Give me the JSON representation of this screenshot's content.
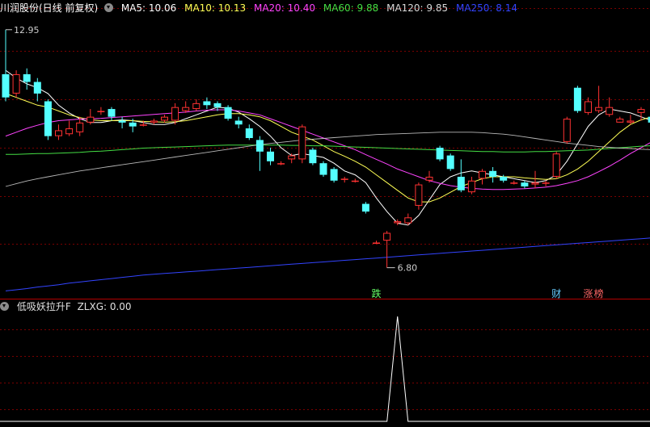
{
  "header": {
    "stock": "川润股份(日线 前复权)",
    "ma": [
      {
        "label": "MA5: 10.06",
        "color": "#ffffff"
      },
      {
        "label": "MA10: 10.13",
        "color": "#ffff55"
      },
      {
        "label": "MA20: 10.40",
        "color": "#ff44ff"
      },
      {
        "label": "MA60: 9.88",
        "color": "#44dd44"
      },
      {
        "label": "MA120: 9.85",
        "color": "#d8d8d8"
      },
      {
        "label": "MA250: 8.14",
        "color": "#3344ff"
      }
    ]
  },
  "indicator": {
    "title": "低吸妖拉升F",
    "value": "ZLXG: 0.00"
  },
  "colors": {
    "up": "#ff3232",
    "down": "#54ffff",
    "grid": "#7a0000",
    "axis": "#b40000"
  },
  "chart_data": {
    "type": "candlestick",
    "price_axis": [
      6.0,
      13.3
    ],
    "high_label": "12.95",
    "low_label": "6.80",
    "candles": [
      [
        11.8,
        11.2,
        12.95,
        11.1
      ],
      [
        11.3,
        11.8,
        11.9,
        11.2
      ],
      [
        11.8,
        11.6,
        11.95,
        11.4
      ],
      [
        11.6,
        11.3,
        11.7,
        11.1
      ],
      [
        11.1,
        10.2,
        11.15,
        10.1
      ],
      [
        10.2,
        10.35,
        10.5,
        10.1
      ],
      [
        10.25,
        10.4,
        10.6,
        10.2
      ],
      [
        10.3,
        10.55,
        10.7,
        10.2
      ],
      [
        10.55,
        10.7,
        10.9,
        10.5
      ],
      [
        10.85,
        10.85,
        10.95,
        10.75
      ],
      [
        10.9,
        10.7,
        10.95,
        10.6
      ],
      [
        10.6,
        10.55,
        10.7,
        10.4
      ],
      [
        10.55,
        10.45,
        10.65,
        10.3
      ],
      [
        10.5,
        10.5,
        10.6,
        10.45
      ],
      [
        10.55,
        10.6,
        10.65,
        10.5
      ],
      [
        10.6,
        10.7,
        10.75,
        10.55
      ],
      [
        10.6,
        10.95,
        11.05,
        10.5
      ],
      [
        10.85,
        10.95,
        11.1,
        10.8
      ],
      [
        10.9,
        11.05,
        11.15,
        10.85
      ],
      [
        11.1,
        11.0,
        11.2,
        10.9
      ],
      [
        11.05,
        10.95,
        11.1,
        10.85
      ],
      [
        10.95,
        10.65,
        11.0,
        10.6
      ],
      [
        10.6,
        10.5,
        10.7,
        10.4
      ],
      [
        10.4,
        10.15,
        10.5,
        10.1
      ],
      [
        10.1,
        9.8,
        10.2,
        9.3
      ],
      [
        9.8,
        9.55,
        9.9,
        9.45
      ],
      [
        9.5,
        9.5,
        9.55,
        9.45
      ],
      [
        9.6,
        9.7,
        9.75,
        9.5
      ],
      [
        9.6,
        10.45,
        10.5,
        9.5
      ],
      [
        9.85,
        9.5,
        9.9,
        9.45
      ],
      [
        9.5,
        9.2,
        9.55,
        9.15
      ],
      [
        9.35,
        9.05,
        9.4,
        9.0
      ],
      [
        9.1,
        9.1,
        9.15,
        9.0
      ],
      [
        9.05,
        9.05,
        9.1,
        9.0
      ],
      [
        8.45,
        8.25,
        8.5,
        8.2
      ],
      [
        7.45,
        7.45,
        7.5,
        7.45
      ],
      [
        7.5,
        7.7,
        7.75,
        6.8
      ],
      [
        7.95,
        8.0,
        8.05,
        7.9
      ],
      [
        7.95,
        8.1,
        8.2,
        7.9
      ],
      [
        8.4,
        8.95,
        9.0,
        8.3
      ],
      [
        9.05,
        9.15,
        9.3,
        9.0
      ],
      [
        9.9,
        9.6,
        9.95,
        9.55
      ],
      [
        9.7,
        9.35,
        9.75,
        9.3
      ],
      [
        9.15,
        8.8,
        9.6,
        8.75
      ],
      [
        8.75,
        9.05,
        9.15,
        8.7
      ],
      [
        9.1,
        9.3,
        9.35,
        8.95
      ],
      [
        9.3,
        9.15,
        9.4,
        9.0
      ],
      [
        9.15,
        9.05,
        9.2,
        9.0
      ],
      [
        9.0,
        9.0,
        9.05,
        8.95
      ],
      [
        9.0,
        8.9,
        9.05,
        8.85
      ],
      [
        8.95,
        9.0,
        9.3,
        8.85
      ],
      [
        9.0,
        9.0,
        9.05,
        8.9
      ],
      [
        9.15,
        9.75,
        9.8,
        9.1
      ],
      [
        10.05,
        10.65,
        10.7,
        10.0
      ],
      [
        11.45,
        10.85,
        11.5,
        10.8
      ],
      [
        10.8,
        11.1,
        11.2,
        10.75
      ],
      [
        10.85,
        10.95,
        11.5,
        10.8
      ],
      [
        10.75,
        10.95,
        11.2,
        10.7
      ],
      [
        10.55,
        10.65,
        10.7,
        10.55
      ],
      [
        10.55,
        10.6,
        10.75,
        10.5
      ],
      [
        10.8,
        10.9,
        10.95,
        10.6
      ],
      [
        10.7,
        10.55,
        10.85,
        10.5
      ]
    ],
    "ma_series": [
      {
        "name": "MA5",
        "values": [
          11.9,
          11.7,
          11.55,
          11.45,
          11.3,
          11.0,
          10.8,
          10.65,
          10.55,
          10.55,
          10.6,
          10.62,
          10.6,
          10.55,
          10.5,
          10.5,
          10.55,
          10.65,
          10.75,
          10.85,
          10.95,
          10.92,
          10.82,
          10.65,
          10.45,
          10.2,
          9.9,
          9.7,
          9.75,
          9.7,
          9.65,
          9.5,
          9.3,
          9.2,
          9.0,
          8.6,
          8.25,
          7.95,
          7.9,
          8.15,
          8.55,
          8.95,
          9.15,
          9.25,
          9.3,
          9.25,
          9.2,
          9.15,
          9.1,
          9.05,
          9.0,
          9.05,
          9.2,
          9.55,
          10.0,
          10.45,
          10.75,
          10.9,
          10.85,
          10.8,
          10.7,
          10.6
        ]
      },
      {
        "name": "MA10",
        "values": [
          11.3,
          11.2,
          11.1,
          11.0,
          10.95,
          10.85,
          10.75,
          10.68,
          10.62,
          10.6,
          10.6,
          10.6,
          10.6,
          10.58,
          10.57,
          10.56,
          10.57,
          10.6,
          10.65,
          10.7,
          10.75,
          10.78,
          10.78,
          10.75,
          10.7,
          10.6,
          10.45,
          10.3,
          10.2,
          10.1,
          9.95,
          9.8,
          9.68,
          9.55,
          9.4,
          9.2,
          9.0,
          8.8,
          8.6,
          8.5,
          8.5,
          8.6,
          8.75,
          8.9,
          9.0,
          9.1,
          9.15,
          9.15,
          9.15,
          9.12,
          9.1,
          9.08,
          9.1,
          9.2,
          9.35,
          9.55,
          9.8,
          10.05,
          10.3,
          10.5,
          10.62,
          10.7
        ]
      },
      {
        "name": "MA20",
        "values": [
          10.2,
          10.3,
          10.4,
          10.48,
          10.55,
          10.6,
          10.62,
          10.64,
          10.65,
          10.66,
          10.68,
          10.7,
          10.72,
          10.74,
          10.76,
          10.78,
          10.8,
          10.82,
          10.85,
          10.87,
          10.88,
          10.88,
          10.85,
          10.8,
          10.75,
          10.65,
          10.55,
          10.45,
          10.35,
          10.25,
          10.15,
          10.05,
          9.95,
          9.85,
          9.72,
          9.6,
          9.48,
          9.35,
          9.25,
          9.15,
          9.05,
          8.98,
          8.92,
          8.88,
          8.85,
          8.83,
          8.82,
          8.82,
          8.83,
          8.84,
          8.86,
          8.88,
          8.92,
          8.98,
          9.05,
          9.15,
          9.28,
          9.42,
          9.58,
          9.75,
          9.9,
          10.05
        ]
      },
      {
        "name": "MA60",
        "values": [
          9.73,
          9.73,
          9.74,
          9.75,
          9.75,
          9.76,
          9.77,
          9.78,
          9.8,
          9.81,
          9.83,
          9.85,
          9.87,
          9.89,
          9.9,
          9.91,
          9.92,
          9.93,
          9.94,
          9.95,
          9.96,
          9.97,
          9.97,
          9.97,
          9.97,
          9.97,
          9.97,
          9.96,
          9.96,
          9.95,
          9.95,
          9.94,
          9.93,
          9.92,
          9.91,
          9.9,
          9.89,
          9.88,
          9.87,
          9.86,
          9.85,
          9.84,
          9.83,
          9.82,
          9.81,
          9.8,
          9.8,
          9.79,
          9.79,
          9.79,
          9.8,
          9.8,
          9.81,
          9.82,
          9.83,
          9.84,
          9.86,
          9.88,
          9.9,
          9.92,
          9.94,
          9.95
        ]
      },
      {
        "name": "MA120",
        "values": [
          8.9,
          8.97,
          9.04,
          9.1,
          9.15,
          9.2,
          9.25,
          9.3,
          9.34,
          9.38,
          9.42,
          9.46,
          9.5,
          9.54,
          9.58,
          9.62,
          9.66,
          9.7,
          9.74,
          9.78,
          9.82,
          9.86,
          9.9,
          9.94,
          9.98,
          10.01,
          10.04,
          10.07,
          10.1,
          10.12,
          10.14,
          10.16,
          10.18,
          10.2,
          10.22,
          10.24,
          10.25,
          10.26,
          10.27,
          10.28,
          10.29,
          10.3,
          10.3,
          10.3,
          10.3,
          10.29,
          10.27,
          10.25,
          10.22,
          10.18,
          10.14,
          10.1,
          10.06,
          10.02,
          9.99,
          9.96,
          9.93,
          9.91,
          9.89,
          9.88,
          9.86,
          9.85
        ]
      },
      {
        "name": "MA250",
        "values": [
          6.2,
          6.23,
          6.26,
          6.3,
          6.33,
          6.36,
          6.4,
          6.43,
          6.46,
          6.49,
          6.52,
          6.55,
          6.58,
          6.61,
          6.63,
          6.65,
          6.67,
          6.69,
          6.71,
          6.73,
          6.75,
          6.77,
          6.79,
          6.81,
          6.83,
          6.85,
          6.87,
          6.89,
          6.91,
          6.93,
          6.95,
          6.97,
          6.99,
          7.01,
          7.03,
          7.05,
          7.07,
          7.09,
          7.11,
          7.13,
          7.15,
          7.17,
          7.19,
          7.21,
          7.23,
          7.25,
          7.27,
          7.29,
          7.31,
          7.33,
          7.35,
          7.37,
          7.39,
          7.41,
          7.43,
          7.45,
          7.47,
          7.49,
          7.51,
          7.53,
          7.55,
          7.57
        ]
      }
    ],
    "markers": [
      {
        "index": 35,
        "text": "跌",
        "color": "#66ff66"
      },
      {
        "index": 52,
        "text": "财",
        "color": "#66ccff"
      },
      {
        "index": 55,
        "text": "涨",
        "color": "#ff6666"
      },
      {
        "index": 56,
        "text": "榜",
        "color": "#ff6666"
      }
    ],
    "indicator": {
      "name": "ZLXG",
      "values_range": [
        0,
        1
      ],
      "pulse_index": 37,
      "pulse_value": 1
    }
  }
}
